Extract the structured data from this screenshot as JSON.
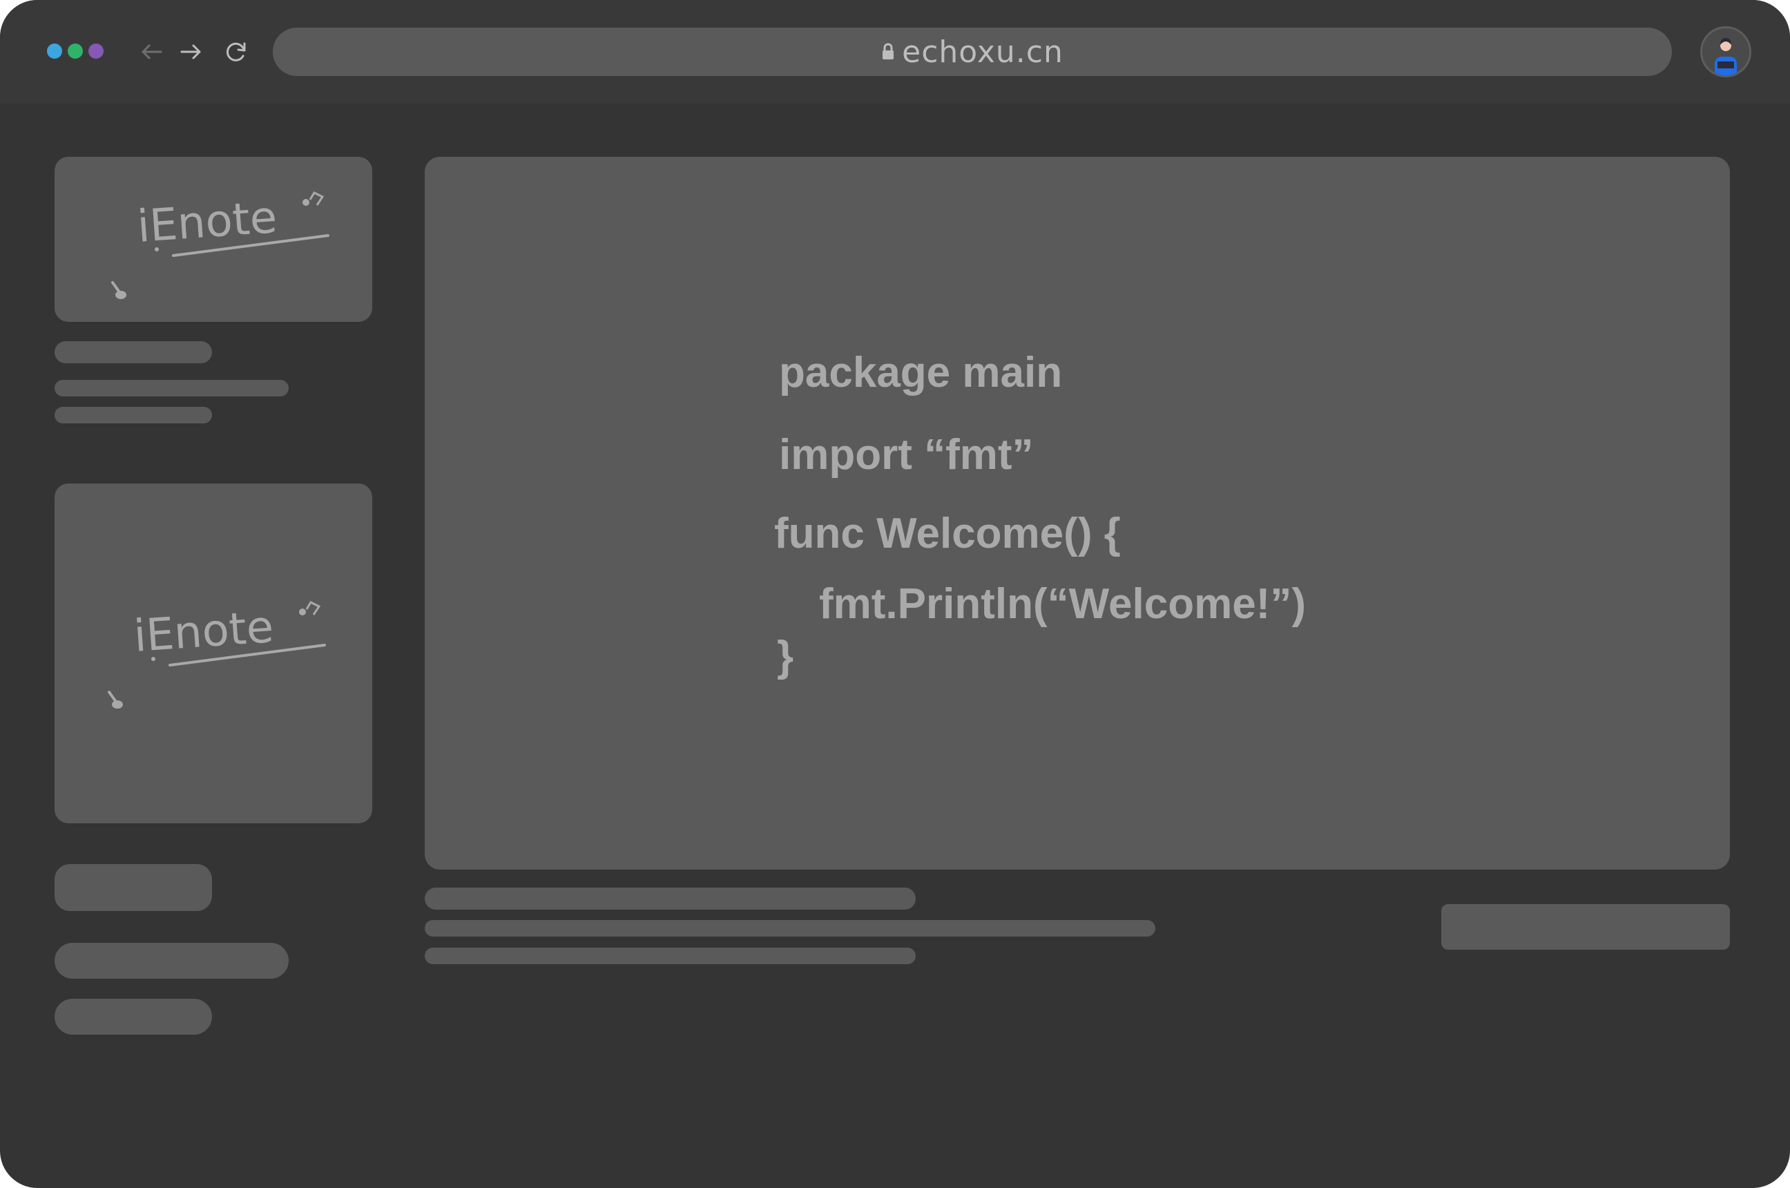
{
  "browser": {
    "window_dots": [
      {
        "name": "dot-blue",
        "color": "#3ba6e0"
      },
      {
        "name": "dot-green",
        "color": "#2fb36b"
      },
      {
        "name": "dot-purple",
        "color": "#8559b5"
      }
    ],
    "nav_icons": [
      "back-arrow-icon",
      "forward-arrow-icon",
      "reload-icon"
    ],
    "address_bar": {
      "url": "echoxu.cn",
      "lock_icon": "lock-icon"
    },
    "avatar_icon": "user-avatar-icon"
  },
  "sidebar": {
    "cards": [
      {
        "logo_text": "iEnote"
      },
      {
        "logo_text": "iEnote"
      }
    ]
  },
  "editor": {
    "code_lines": [
      "package main",
      "import “fmt”",
      "func Welcome() {",
      "fmt.Println(“Welcome!”)",
      "}"
    ]
  },
  "colors": {
    "window_bg": "#343434",
    "titlebar_bg": "#393939",
    "panel": "#5a5a5a",
    "text": "#a9a9a9"
  }
}
